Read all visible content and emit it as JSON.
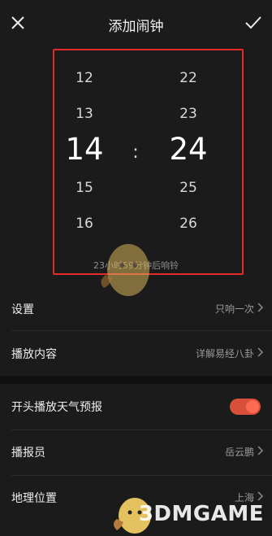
{
  "header": {
    "title": "添加闹钟"
  },
  "picker": {
    "hours": [
      "12",
      "13",
      "14",
      "15",
      "16"
    ],
    "minutes": [
      "22",
      "23",
      "24",
      "25",
      "26"
    ],
    "separator": ":",
    "countdown": "23小时59分钟后响铃"
  },
  "settings": [
    {
      "label": "设置",
      "value": "只响一次"
    },
    {
      "label": "播放内容",
      "value": "详解易经八卦"
    }
  ],
  "options": [
    {
      "label": "开头播放天气预报",
      "toggle_on": true
    },
    {
      "label": "播报员",
      "value": "岳云鹏"
    },
    {
      "label": "地理位置",
      "value": "上海"
    }
  ],
  "watermark": {
    "text": "3DMGAME"
  },
  "colors": {
    "highlight_box": "#e52a2a",
    "toggle_active": "#d9503a",
    "background": "#1b1b1b"
  }
}
